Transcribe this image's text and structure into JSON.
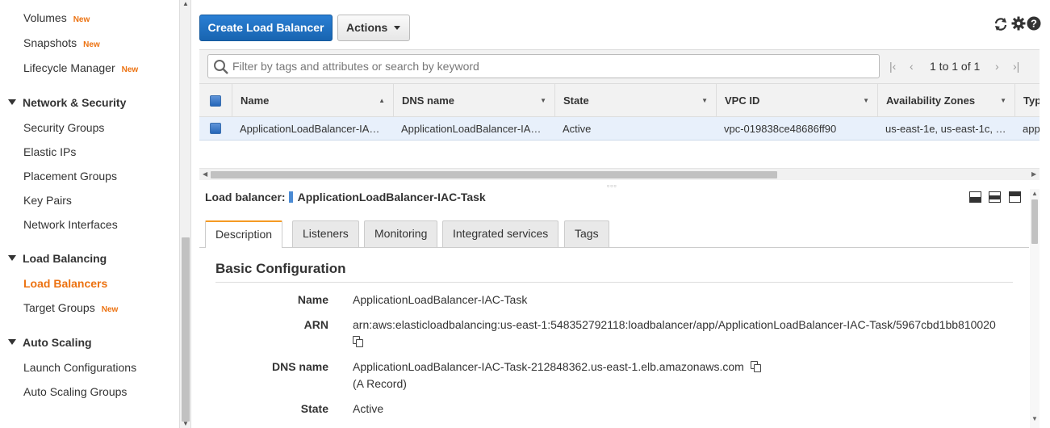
{
  "sidebar": {
    "items": [
      {
        "label": "Volumes",
        "badge": "New"
      },
      {
        "label": "Snapshots",
        "badge": "New"
      },
      {
        "label": "Lifecycle Manager",
        "badge": "New"
      }
    ],
    "sections": [
      {
        "title": "Network & Security",
        "items": [
          "Security Groups",
          "Elastic IPs",
          "Placement Groups",
          "Key Pairs",
          "Network Interfaces"
        ]
      },
      {
        "title": "Load Balancing",
        "items": [
          "Load Balancers",
          "Target Groups"
        ],
        "target_groups_badge": "New"
      },
      {
        "title": "Auto Scaling",
        "items": [
          "Launch Configurations",
          "Auto Scaling Groups"
        ]
      }
    ]
  },
  "toolbar": {
    "create_label": "Create Load Balancer",
    "actions_label": "Actions"
  },
  "filter": {
    "placeholder": "Filter by tags and attributes or search by keyword",
    "pager": "1 to 1 of 1"
  },
  "table": {
    "columns": [
      "Name",
      "DNS name",
      "State",
      "VPC ID",
      "Availability Zones",
      "Type"
    ],
    "rows": [
      {
        "name": "ApplicationLoadBalancer-IA…",
        "dns": "ApplicationLoadBalancer-IA…",
        "state": "Active",
        "vpc": "vpc-019838ce48686ff90",
        "az": "us-east-1e, us-east-1c, …",
        "type": "appl"
      }
    ]
  },
  "details": {
    "title_prefix": "Load balancer:",
    "title_name": "ApplicationLoadBalancer-IAC-Task",
    "tabs": [
      "Description",
      "Listeners",
      "Monitoring",
      "Integrated services",
      "Tags"
    ],
    "section_title": "Basic Configuration",
    "fields": [
      {
        "label": "Name",
        "value": "ApplicationLoadBalancer-IAC-Task"
      },
      {
        "label": "ARN",
        "value": "arn:aws:elasticloadbalancing:us-east-1:548352792118:loadbalancer/app/ApplicationLoadBalancer-IAC-Task/5967cbd1bb810020"
      },
      {
        "label": "DNS name",
        "value": "ApplicationLoadBalancer-IAC-Task-212848362.us-east-1.elb.amazonaws.com",
        "note": "(A Record)"
      },
      {
        "label": "State",
        "value": "Active"
      }
    ]
  },
  "colors": {
    "accent": "#ec7211",
    "primary_button": "#1e6fc4",
    "selected_row": "#e8f0fb"
  }
}
